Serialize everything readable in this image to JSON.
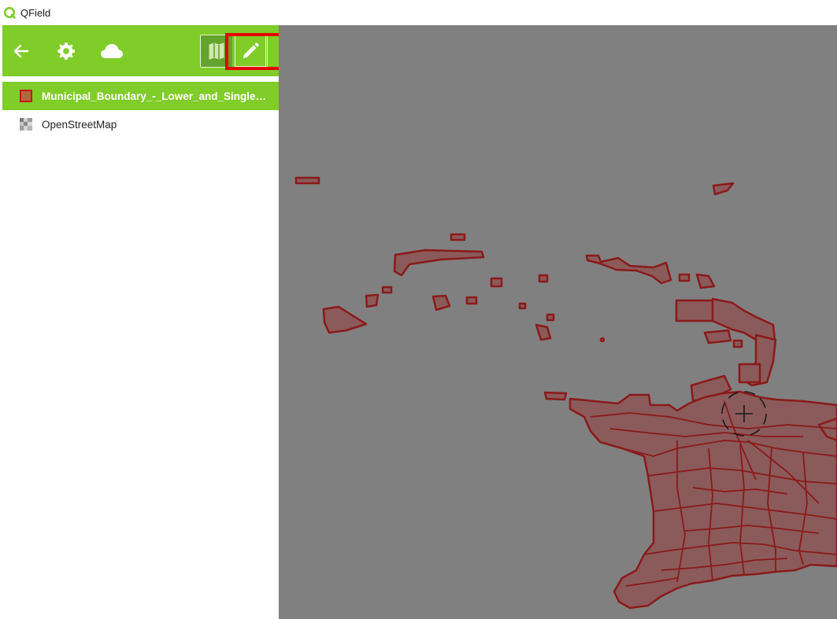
{
  "app": {
    "title": "QField"
  },
  "toolbar": {
    "back_icon": "arrow-left-icon",
    "settings_icon": "gear-icon",
    "cloud_icon": "cloud-icon",
    "browse_mode_icon": "map-icon",
    "digitize_mode_icon": "pencil-icon"
  },
  "layers": [
    {
      "name": "Municipal_Boundary_-_Lower_and_Single_Tier",
      "selected": true,
      "icon": "polygon-layer-icon"
    },
    {
      "name": "OpenStreetMap",
      "selected": false,
      "icon": "raster-layer-icon"
    }
  ],
  "colors": {
    "accent": "#80cc28",
    "accent_dark": "#64a32c",
    "map_background": "#808080",
    "feature_fill": "#8b5a5a",
    "feature_stroke": "#8b1a1a",
    "highlight": "#e60000"
  }
}
